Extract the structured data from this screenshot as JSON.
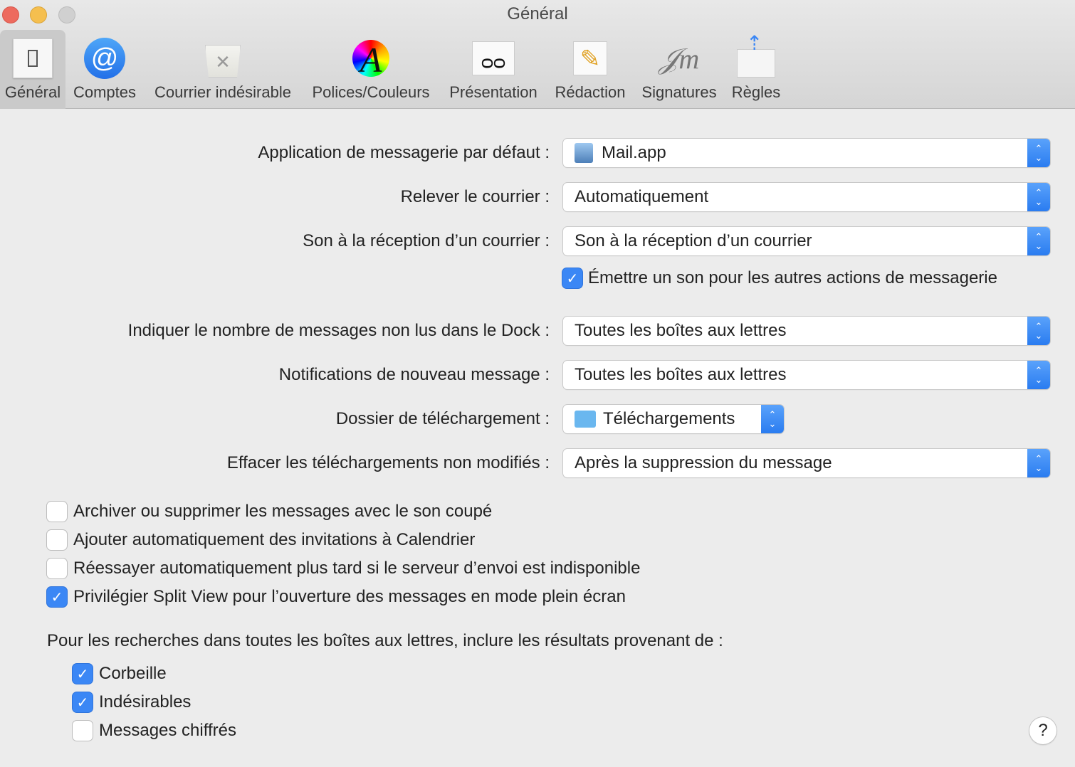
{
  "window": {
    "title": "Général"
  },
  "toolbar": [
    {
      "label": "Général",
      "icon": "general-switch-icon"
    },
    {
      "label": "Comptes",
      "icon": "at-icon"
    },
    {
      "label": "Courrier indésirable",
      "icon": "junk-bin-icon"
    },
    {
      "label": "Polices/Couleurs",
      "icon": "fonts-colors-icon"
    },
    {
      "label": "Présentation",
      "icon": "glasses-icon"
    },
    {
      "label": "Rédaction",
      "icon": "pencil-icon"
    },
    {
      "label": "Signatures",
      "icon": "signature-icon"
    },
    {
      "label": "Règles",
      "icon": "rules-envelope-icon"
    }
  ],
  "settings": [
    {
      "label": "Application de messagerie par défaut :",
      "value": "Mail.app"
    },
    {
      "label": "Relever le courrier :",
      "value": "Automatiquement"
    },
    {
      "label": "Son à la réception d’un courrier :",
      "value": "Son à la réception d’un courrier"
    },
    {
      "label": "Indiquer le nombre de messages non lus dans le Dock :",
      "value": "Toutes les boîtes aux lettres"
    },
    {
      "label": "Notifications de nouveau message :",
      "value": "Toutes les boîtes aux lettres"
    },
    {
      "label": "Dossier de téléchargement :",
      "value": "Téléchargements"
    },
    {
      "label": "Effacer les téléchargements non modifiés :",
      "value": "Après la suppression du message"
    }
  ],
  "sound_checkbox": {
    "label": "Émettre un son pour les autres actions de messagerie",
    "checked": true
  },
  "options": [
    {
      "label": "Archiver ou supprimer les messages avec le son coupé",
      "checked": false
    },
    {
      "label": "Ajouter automatiquement des invitations à Calendrier",
      "checked": false
    },
    {
      "label": "Réessayer automatiquement plus tard si le serveur d’envoi est indisponible",
      "checked": false
    },
    {
      "label": "Privilégier Split View pour l’ouverture des messages en mode plein écran",
      "checked": true
    }
  ],
  "search": {
    "heading": "Pour les recherches dans toutes les boîtes aux lettres, inclure les résultats provenant de :",
    "items": [
      {
        "label": "Corbeille",
        "checked": true
      },
      {
        "label": "Indésirables",
        "checked": true
      },
      {
        "label": "Messages chiffrés",
        "checked": false
      }
    ]
  },
  "help": "?",
  "check_glyph": "✓"
}
